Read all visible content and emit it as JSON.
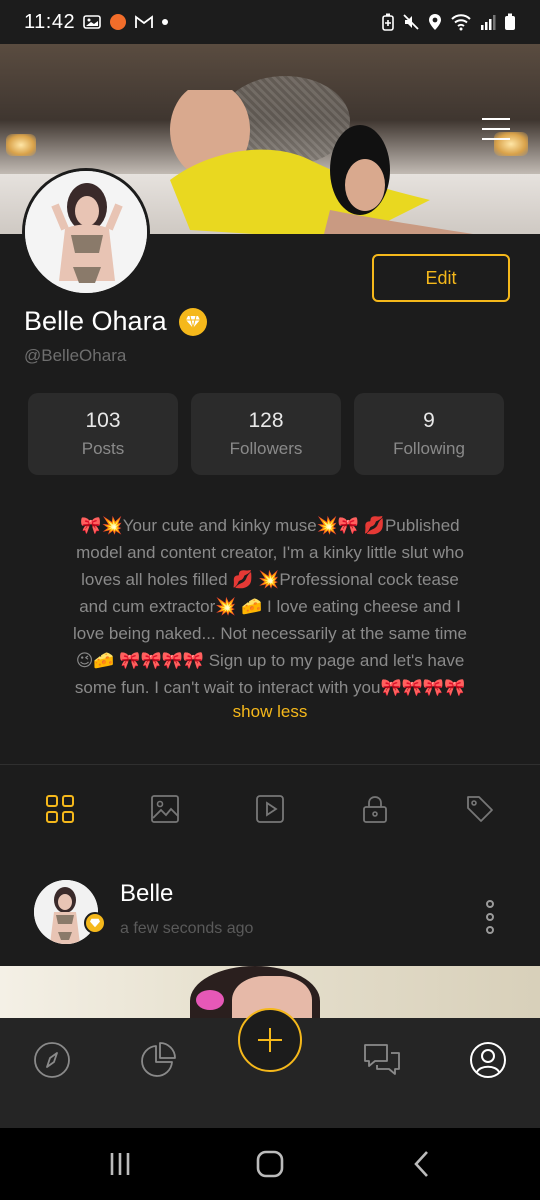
{
  "status_bar": {
    "time": "11:42",
    "left_icons": [
      "gallery-icon",
      "notification-dot-icon",
      "gmail-icon",
      "dot-icon"
    ],
    "right_icons": [
      "battery-saver-icon",
      "mute-icon",
      "location-icon",
      "wifi-icon",
      "signal-icon",
      "battery-icon"
    ]
  },
  "profile": {
    "display_name": "Belle Ohara",
    "username": "@BelleOhara",
    "edit_label": "Edit",
    "stats": [
      {
        "value": "103",
        "label": "Posts"
      },
      {
        "value": "128",
        "label": "Followers"
      },
      {
        "value": "9",
        "label": "Following"
      }
    ],
    "bio_lines": [
      "🎀💥Your cute and kinky muse💥🎀 💋Published",
      "model and content creator, I'm a kinky little slut who",
      "loves all holes filled 💋 💥Professional cock tease",
      "and cum extractor💥 🧀 I love eating cheese and I",
      "love being naked... Not necessarily at the same time",
      "😉🧀 🎀🎀🎀🎀 Sign up to my page and let's have",
      "some fun. I can't wait to interact with you🎀🎀🎀🎀"
    ],
    "show_less": "show less"
  },
  "tabs": [
    "grid-icon",
    "image-icon",
    "video-icon",
    "lock-icon",
    "tag-icon"
  ],
  "post": {
    "author": "Belle",
    "time": "a few seconds ago"
  },
  "colors": {
    "background": "#1c1c1c",
    "accent": "#f5b81b",
    "card": "#2b2b2b",
    "muted_text": "#8a8a8a"
  }
}
